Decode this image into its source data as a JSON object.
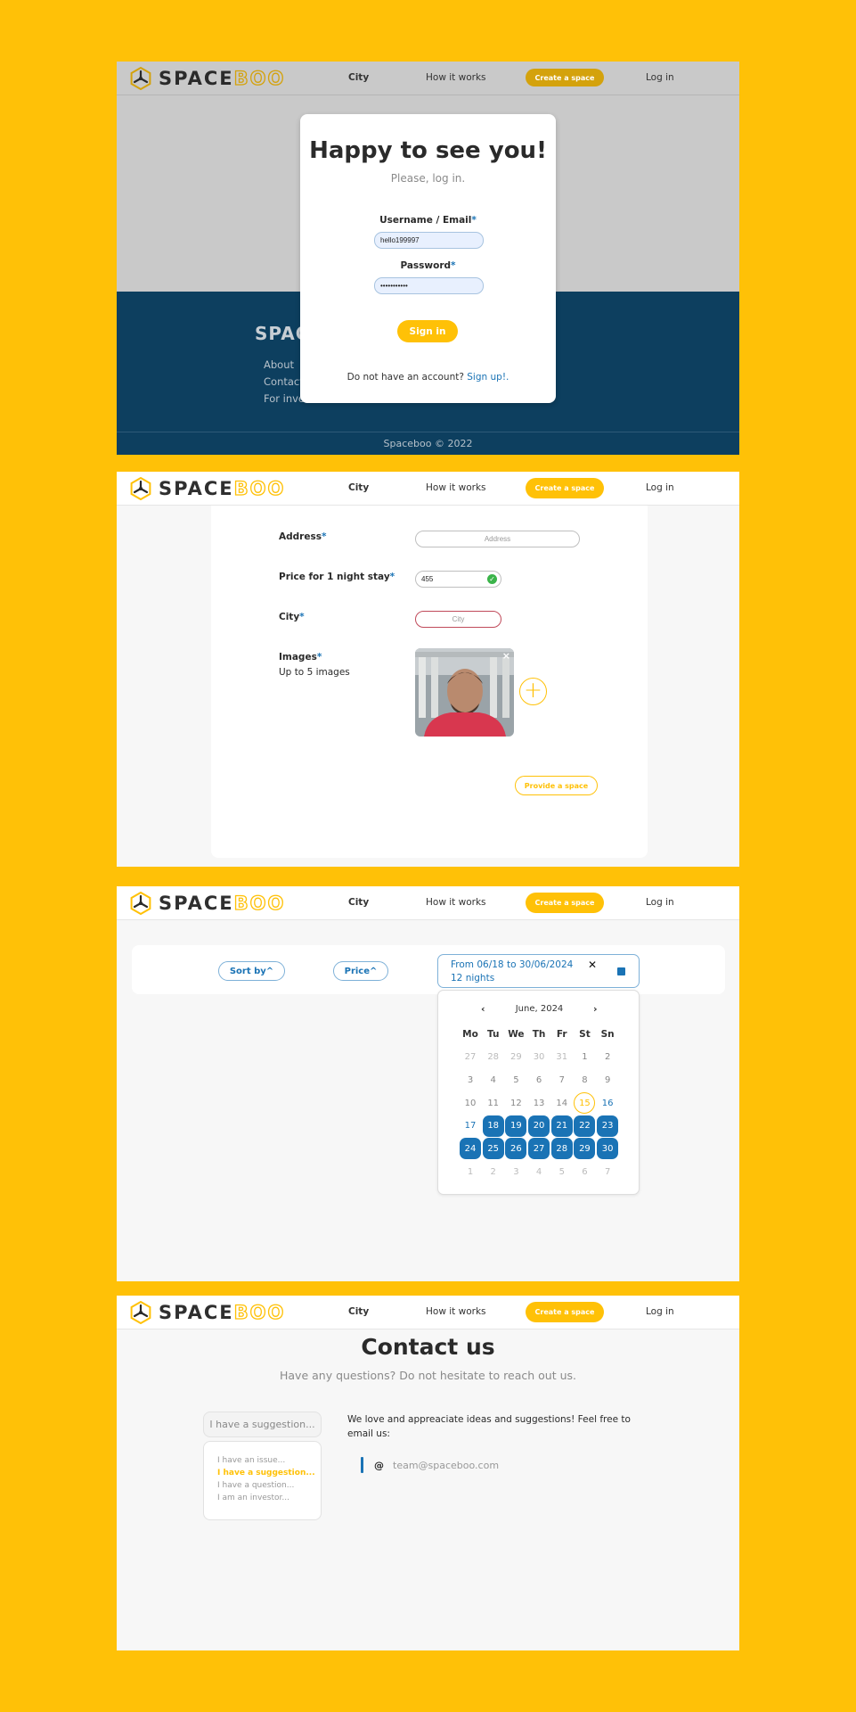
{
  "brand": {
    "part1": "SPACE",
    "part2": "BOO"
  },
  "nav": {
    "city": "City",
    "how": "How it works",
    "create": "Create a space",
    "login": "Log in"
  },
  "login": {
    "title": "Happy to see you!",
    "subtitle": "Please, log in.",
    "user_label": "Username / Email",
    "user_value": "hello199997",
    "pass_label": "Password",
    "pass_value": "•••••••••••",
    "signin": "Sign in",
    "no_account": "Do not have an account?",
    "signup": "Sign up!."
  },
  "footer": {
    "brand": "SPACEBOO",
    "links": [
      "About",
      "Contact",
      "For investors"
    ],
    "copyright": "Spaceboo © 2022"
  },
  "space_form": {
    "address_label": "Address",
    "address_placeholder": "Address",
    "price_label": "Price for 1 night stay",
    "price_value": "455",
    "city_label": "City",
    "city_placeholder": "City",
    "images_label": "Images",
    "images_hint": "Up to 5 images",
    "provide_button": "Provide a space"
  },
  "filters": {
    "sort": "Sort by^",
    "price": "Price^",
    "date_range": "From 06/18 to 30/06/2024",
    "nights": "12 nights",
    "calendar": {
      "month": "June, 2024",
      "weekdays": [
        "Mo",
        "Tu",
        "We",
        "Th",
        "Fr",
        "St",
        "Sn"
      ],
      "weeks": [
        [
          "27",
          "28",
          "29",
          "30",
          "31",
          "1",
          "2"
        ],
        [
          "3",
          "4",
          "5",
          "6",
          "7",
          "8",
          "9"
        ],
        [
          "10",
          "11",
          "12",
          "13",
          "14",
          "15",
          "16"
        ],
        [
          "17",
          "18",
          "19",
          "20",
          "21",
          "22",
          "23"
        ],
        [
          "24",
          "25",
          "26",
          "27",
          "28",
          "29",
          "30"
        ],
        [
          "1",
          "2",
          "3",
          "4",
          "5",
          "6",
          "7"
        ]
      ]
    }
  },
  "contact": {
    "title": "Contact us",
    "subtitle": "Have any questions? Do not hesitate to reach out us.",
    "selected": "I have a suggestion...",
    "options": [
      "I have an issue...",
      "I have a suggestion...",
      "I have a question...",
      "I am an investor..."
    ],
    "text": "We love and appreaciate ideas and suggestions! Feel free to email us:",
    "email": "team@spaceboo.com"
  },
  "colors": {
    "accent": "#FFC107",
    "primary": "#1a73b5",
    "footer": "#0d3f5f"
  }
}
